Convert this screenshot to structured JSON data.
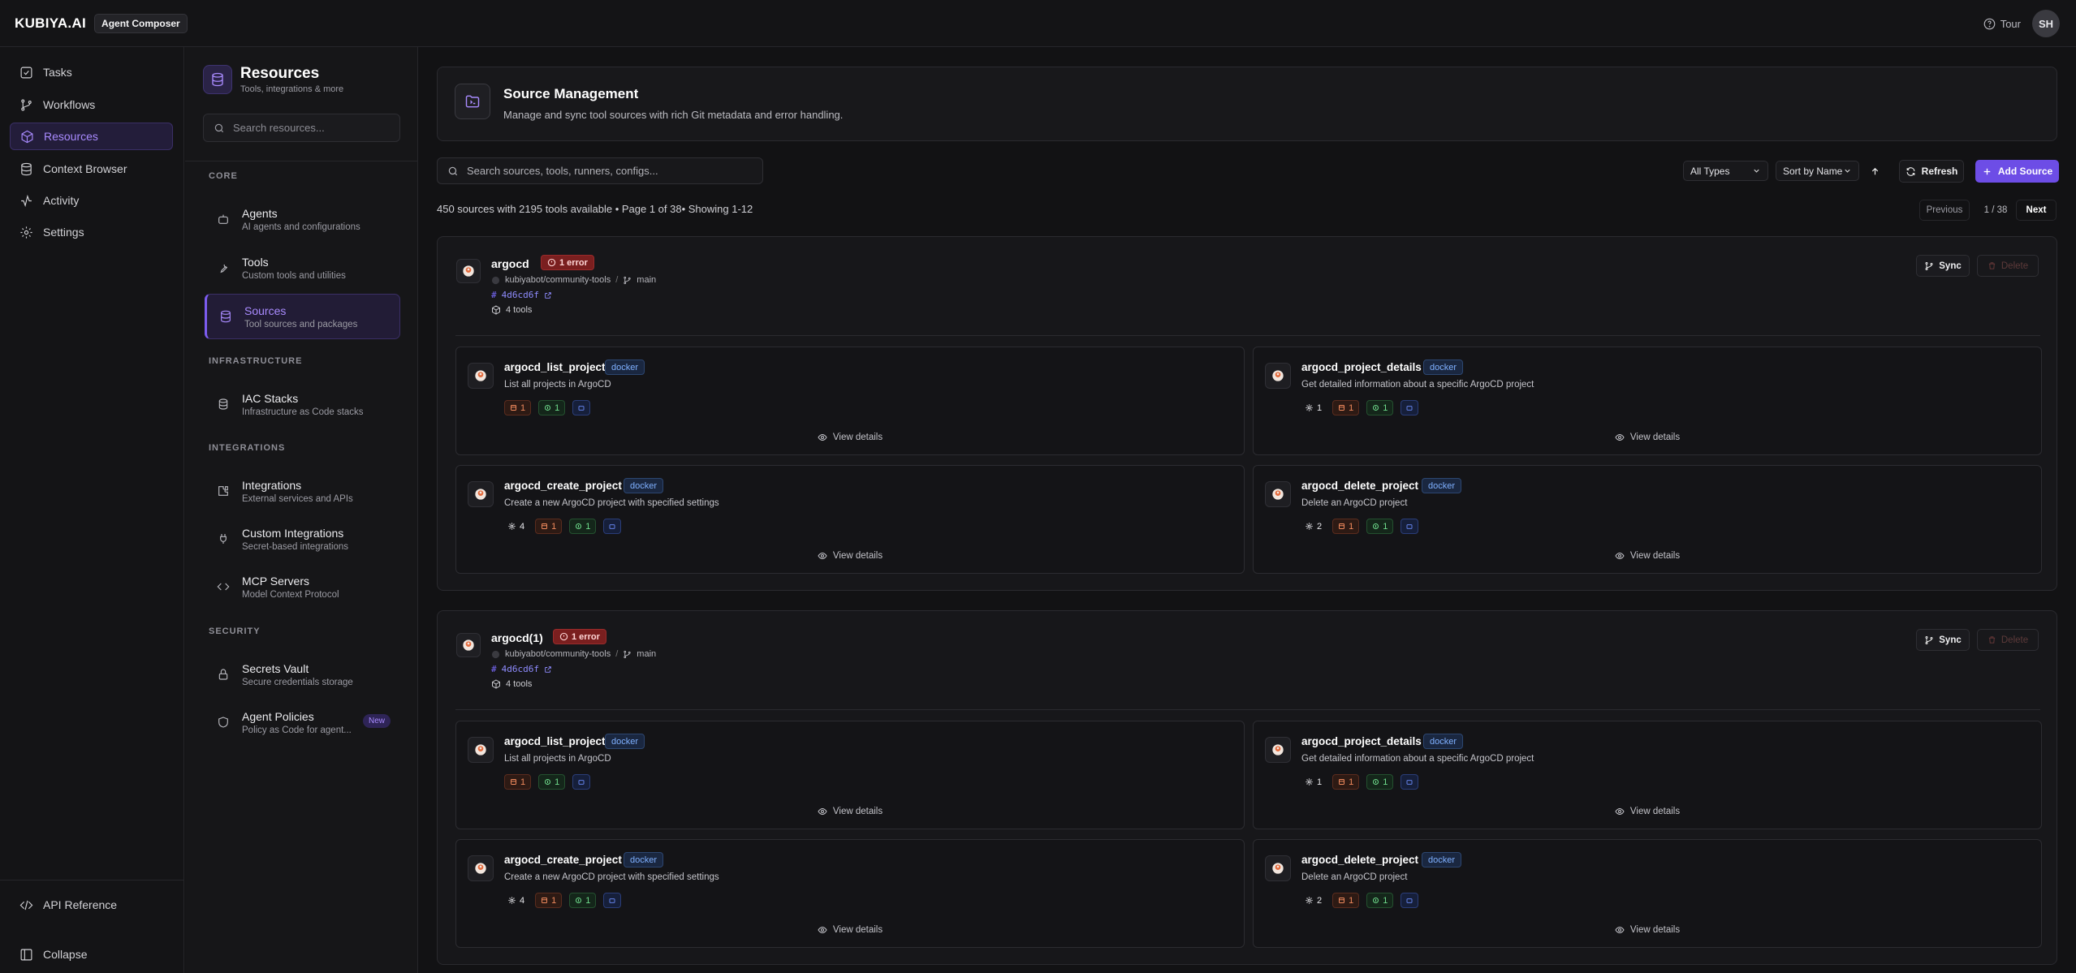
{
  "topbar": {
    "brand": "KUBIYA.AI",
    "product": "Agent Composer",
    "tour": "Tour",
    "avatar_initials": "SH"
  },
  "nav": {
    "items": [
      {
        "label": "Tasks",
        "icon": "checkbox-icon"
      },
      {
        "label": "Workflows",
        "icon": "git-branch-icon"
      },
      {
        "label": "Resources",
        "icon": "package-icon",
        "active": true
      },
      {
        "label": "Context Browser",
        "icon": "database-icon"
      },
      {
        "label": "Activity",
        "icon": "activity-icon"
      },
      {
        "label": "Settings",
        "icon": "gear-icon"
      }
    ],
    "api_reference": "API Reference",
    "collapse": "Collapse"
  },
  "resources": {
    "title": "Resources",
    "subtitle": "Tools, integrations & more",
    "search_placeholder": "Search resources...",
    "sections": {
      "core": "CORE",
      "infrastructure": "INFRASTRUCTURE",
      "integrations": "INTEGRATIONS",
      "security": "SECURITY"
    },
    "items": {
      "agents": {
        "label": "Agents",
        "desc": "AI agents and configurations"
      },
      "tools": {
        "label": "Tools",
        "desc": "Custom tools and utilities"
      },
      "sources": {
        "label": "Sources",
        "desc": "Tool sources and packages"
      },
      "iac": {
        "label": "IAC Stacks",
        "desc": "Infrastructure as Code stacks"
      },
      "integrations": {
        "label": "Integrations",
        "desc": "External services and APIs"
      },
      "custom_integrations": {
        "label": "Custom Integrations",
        "desc": "Secret-based integrations"
      },
      "mcp": {
        "label": "MCP Servers",
        "desc": "Model Context Protocol"
      },
      "secrets": {
        "label": "Secrets Vault",
        "desc": "Secure credentials storage"
      },
      "policies": {
        "label": "Agent Policies",
        "desc": "Policy as Code for agent...",
        "badge": "New"
      }
    }
  },
  "main": {
    "title": "Source Management",
    "subtitle": "Manage and sync tool sources with rich Git metadata and error handling.",
    "search_placeholder": "Search sources, tools, runners, configs...",
    "filter_type": "All Types",
    "sort": "Sort by Name",
    "refresh": "Refresh",
    "add_source": "Add Source",
    "summary": "450 sources with 2195 tools available  • Page 1 of 38• Showing 1-12",
    "pager": {
      "previous": "Previous",
      "page": "1 / 38",
      "next": "Next"
    }
  },
  "sources": [
    {
      "name": "argocd",
      "error": "1 error",
      "repo": "kubiyabot/community-tools",
      "branch": "main",
      "commit": "4d6cd6f",
      "tools_count": "4 tools",
      "sync": "Sync",
      "delete": "Delete",
      "tools": [
        {
          "name": "argocd_list_projects",
          "tag": "docker",
          "desc": "List all projects in ArgoCD",
          "gear": "",
          "red": "1",
          "green": "1",
          "view": "View details"
        },
        {
          "name": "argocd_project_details",
          "tag": "docker",
          "desc": "Get detailed information about a specific ArgoCD project",
          "gear": "1",
          "red": "1",
          "green": "1",
          "view": "View details"
        },
        {
          "name": "argocd_create_project",
          "tag": "docker",
          "desc": "Create a new ArgoCD project with specified settings",
          "gear": "4",
          "red": "1",
          "green": "1",
          "view": "View details"
        },
        {
          "name": "argocd_delete_project",
          "tag": "docker",
          "desc": "Delete an ArgoCD project",
          "gear": "2",
          "red": "1",
          "green": "1",
          "view": "View details"
        }
      ]
    },
    {
      "name": "argocd(1)",
      "error": "1 error",
      "repo": "kubiyabot/community-tools",
      "branch": "main",
      "commit": "4d6cd6f",
      "tools_count": "4 tools",
      "sync": "Sync",
      "delete": "Delete",
      "tools": [
        {
          "name": "argocd_list_projects",
          "tag": "docker",
          "desc": "List all projects in ArgoCD",
          "gear": "",
          "red": "1",
          "green": "1",
          "view": "View details"
        },
        {
          "name": "argocd_project_details",
          "tag": "docker",
          "desc": "Get detailed information about a specific ArgoCD project",
          "gear": "1",
          "red": "1",
          "green": "1",
          "view": "View details"
        },
        {
          "name": "argocd_create_project",
          "tag": "docker",
          "desc": "Create a new ArgoCD project with specified settings",
          "gear": "4",
          "red": "1",
          "green": "1",
          "view": "View details"
        },
        {
          "name": "argocd_delete_project",
          "tag": "docker",
          "desc": "Delete an ArgoCD project",
          "gear": "2",
          "red": "1",
          "green": "1",
          "view": "View details"
        }
      ]
    }
  ]
}
